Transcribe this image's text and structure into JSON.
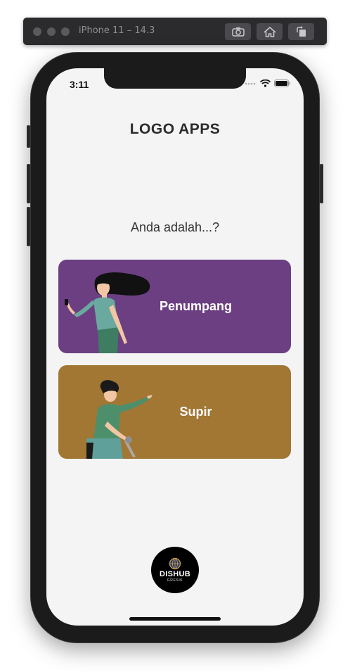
{
  "simulator": {
    "title": "iPhone 11 – 14.3",
    "buttons": [
      "screenshot-icon",
      "home-icon",
      "rotate-icon"
    ]
  },
  "status_bar": {
    "time": "3:11",
    "icons": [
      "signal-icon",
      "wifi-icon",
      "battery-icon"
    ]
  },
  "app": {
    "title": "LOGO APPS",
    "question": "Anda adalah...?",
    "options": [
      {
        "label": "Penumpang",
        "color": "#6b3f82"
      },
      {
        "label": "Supir",
        "color": "#a27633"
      }
    ],
    "footer_logo": {
      "text": "DISHUB",
      "subtext": "GRESIK"
    }
  },
  "colors": {
    "screen_bg": "#f4f4f5",
    "purple_card": "#6b3f82",
    "gold_card": "#a27633",
    "text_dark": "#2b2b2b"
  }
}
